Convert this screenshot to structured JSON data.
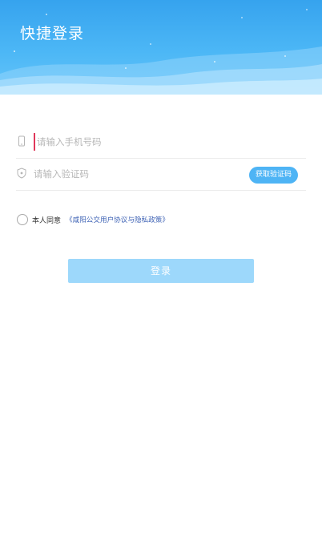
{
  "header": {
    "title": "快捷登录"
  },
  "form": {
    "phone": {
      "placeholder": "请输入手机号码",
      "icon": "phone-icon"
    },
    "code": {
      "placeholder": "请输入验证码",
      "icon": "shield-icon",
      "button_label": "获取验证码"
    },
    "agreement": {
      "text": "本人同意",
      "link_text": "《咸阳公交用户协议与隐私政策》"
    },
    "login_label": "登录"
  },
  "colors": {
    "header": "#3fb0f3",
    "accent": "#4eb4f5",
    "login_button": "#9dd8fb",
    "link": "#3f63b5"
  }
}
